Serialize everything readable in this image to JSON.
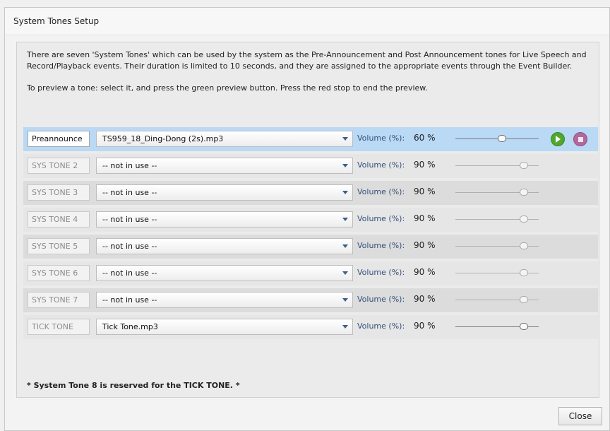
{
  "window": {
    "title": "System Tones Setup"
  },
  "description": {
    "paragraph1": "There are seven 'System Tones' which can be used by the system as the Pre-Announcement and Post Announcement tones for Live Speech and Record/Playback events. Their duration is limited to 10 seconds, and they are assigned to the appropriate events through the Event Builder.",
    "paragraph2": "To preview a tone: select it, and press the green preview button. Press the red stop to end the preview."
  },
  "volume_label": "Volume (%):",
  "tones": [
    {
      "name": "Preannounce",
      "file": "TS959_18_Ding-Dong (2s).mp3",
      "volume_text": "60 %",
      "volume_level": 0.6,
      "selected": true
    },
    {
      "name": "SYS TONE 2",
      "file": "-- not in use --",
      "volume_text": "90 %",
      "volume_level": 0.9,
      "selected": false
    },
    {
      "name": "SYS TONE 3",
      "file": "-- not in use --",
      "volume_text": "90 %",
      "volume_level": 0.9,
      "selected": false
    },
    {
      "name": "SYS TONE 4",
      "file": "-- not in use --",
      "volume_text": "90 %",
      "volume_level": 0.9,
      "selected": false
    },
    {
      "name": "SYS TONE 5",
      "file": "-- not in use --",
      "volume_text": "90 %",
      "volume_level": 0.9,
      "selected": false
    },
    {
      "name": "SYS TONE 6",
      "file": "-- not in use --",
      "volume_text": "90 %",
      "volume_level": 0.9,
      "selected": false
    },
    {
      "name": "SYS TONE 7",
      "file": "-- not in use --",
      "volume_text": "90 %",
      "volume_level": 0.9,
      "selected": false
    },
    {
      "name": "TICK TONE",
      "file": "Tick Tone.mp3",
      "volume_text": "90 %",
      "volume_level": 0.9,
      "selected": false
    }
  ],
  "icons": {
    "play": "play-icon",
    "stop": "stop-icon",
    "dropdown": "chevron-down-icon"
  },
  "colors": {
    "selected_row": "#b9d9f5",
    "play_button": "#4fa72e",
    "stop_button": "#b16a9e"
  },
  "footer_note": "* System Tone 8 is reserved for the TICK TONE. *",
  "close_label": "Close"
}
